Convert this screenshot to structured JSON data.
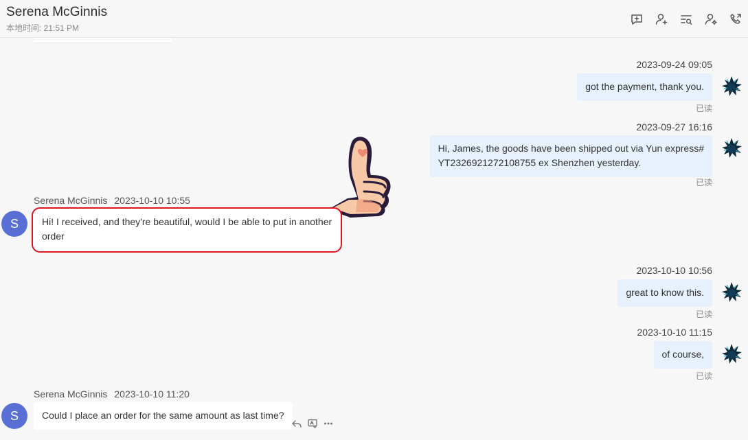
{
  "header": {
    "contact_name": "Serena McGinnis",
    "local_time": "本地时间: 21:51 PM",
    "tools": [
      {
        "icon": "add-comment-icon"
      },
      {
        "icon": "add-user-icon"
      },
      {
        "icon": "search-messages-icon"
      },
      {
        "icon": "user-settings-icon"
      },
      {
        "icon": "call-icon"
      }
    ]
  },
  "messages": [
    {
      "direction": "out",
      "timestamp": "2023-09-24 09:05",
      "text": "got the payment, thank you.",
      "status": "已读"
    },
    {
      "direction": "out",
      "timestamp": "2023-09-27 16:16",
      "lines": [
        "Hi, James, the goods have been shipped out via Yun express#",
        "YT2326921272108755 ex Shenzhen yesterday."
      ],
      "status": "已读"
    },
    {
      "direction": "in",
      "sender": "Serena McGinnis",
      "timestamp": "2023-10-10 10:55",
      "lines": [
        "Hi! I received, and they're beautiful, would I be able to put in another",
        "order"
      ],
      "avatar_letter": "S",
      "sticker": "thumbs-up-sticker"
    },
    {
      "direction": "out",
      "timestamp": "2023-10-10 10:56",
      "text": "great to know this.",
      "status": "已读"
    },
    {
      "direction": "out",
      "timestamp": "2023-10-10 11:15",
      "text": "of course,",
      "status": "已读"
    },
    {
      "direction": "in",
      "sender": "Serena McGinnis",
      "timestamp": "2023-10-10 11:20",
      "text": "Could I place an order for the same amount as last time?",
      "avatar_letter": "S"
    }
  ],
  "colors": {
    "outgoing_bubble": "#e6f1fd",
    "incoming_bubble": "#ffffff",
    "avatar": "#5a6fd6",
    "highlight_border": "#e0141e"
  }
}
